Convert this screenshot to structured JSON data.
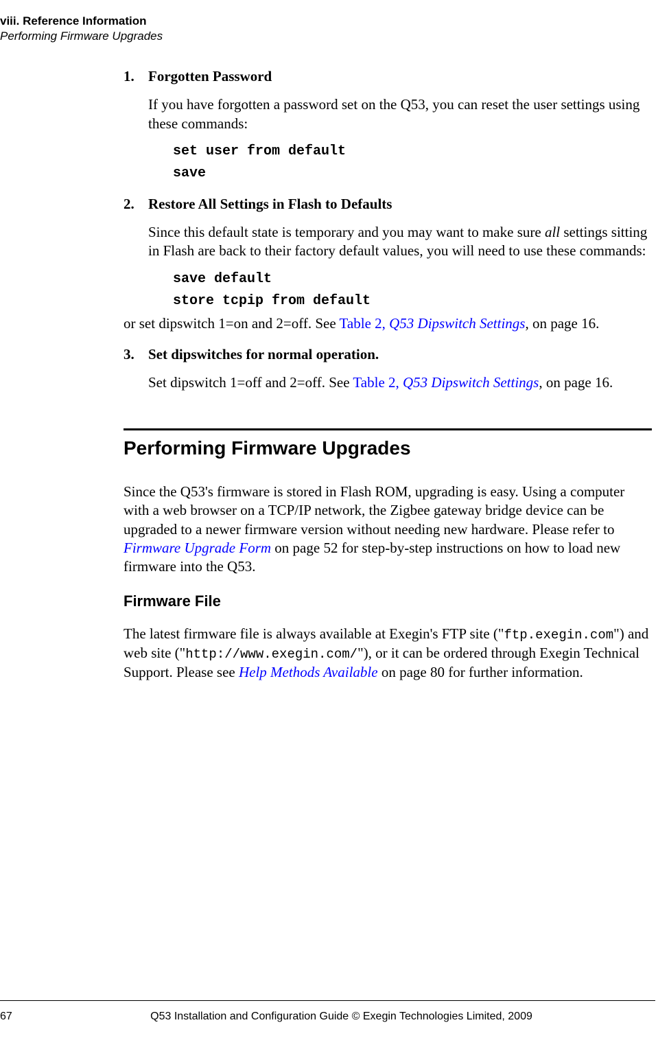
{
  "header": {
    "chapter": "viii. Reference Information",
    "section": "Performing Firmware Upgrades"
  },
  "list": {
    "items": [
      {
        "num": "1.",
        "title": "Forgotten Password",
        "para1_a": "If you have forgotten a password set on the Q53, you can reset the user settings using these commands:",
        "code1": "set user from default",
        "code2": "save"
      },
      {
        "num": "2.",
        "title": "Restore All Settings in Flash to Defaults",
        "para1_a": "Since this default state is temporary and you may want to make sure ",
        "para1_ital": "all",
        "para1_b": " settings sitting in Flash are back to their factory default values, you will need to use these commands:",
        "code1": "save default",
        "code2": "store tcpip from default",
        "para2_a": "or set dipswitch 1=on and 2=off. See ",
        "para2_link1": "Table 2, ",
        "para2_link2": "Q53 Dipswitch Settings",
        "para2_b": ", on page 16."
      },
      {
        "num": "3.",
        "title": "Set dipswitches for normal operation.",
        "para1_a": "Set dipswitch 1=off and 2=off. See ",
        "para1_link1": "Table 2, ",
        "para1_link2": "Q53 Dipswitch Settings",
        "para1_b": ", on page 16."
      }
    ]
  },
  "section": {
    "title": "Performing Firmware Upgrades",
    "body_a": "Since the Q53's firmware is stored in Flash ROM, upgrading is easy. Using a computer with a web browser on a TCP/IP network, the Zigbee gateway bridge device can be upgraded to a newer firmware version without needing new hardware. Please refer to ",
    "body_link": "Firmware Upgrade Form",
    "body_b": " on page 52 for step-by-step instructions on how to load new firmware into the Q53."
  },
  "subsection": {
    "title": "Firmware File",
    "body_a": "The latest firmware file is always available at Exegin's FTP site (\"",
    "mono1": "ftp.exegin.com",
    "body_b": "\") and web site (\"",
    "mono2": "http://www.exegin.com/",
    "body_c": "\"), or it can be ordered through Exegin Technical Support. Please see ",
    "body_link": "Help Methods Available",
    "body_d": " on page 80 for further information."
  },
  "footer": {
    "page": "67",
    "mid": "Q53 Installation and Configuration Guide  © Exegin Technologies Limited, 2009"
  }
}
